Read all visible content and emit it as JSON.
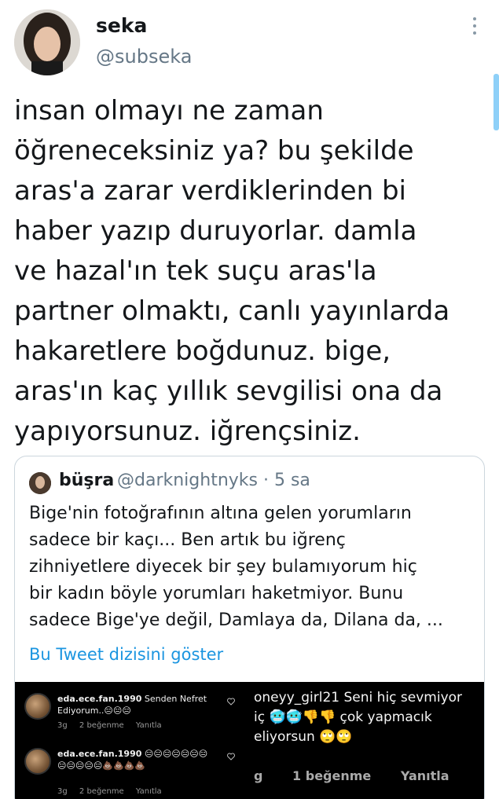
{
  "user": {
    "name": "seka",
    "handle": "@subseka"
  },
  "tweet": {
    "lines": [
      "insan olmayı ne zaman",
      "öğreneceksiniz ya? bu şekilde",
      "aras'a zarar verdiklerinden bi",
      "haber yazıp duruyorlar. damla",
      "ve hazal'ın tek suçu aras'la",
      "partner olmaktı, canlı yayınlarda",
      "hakaretlere boğdunuz. bige,",
      "aras'ın kaç yıllık sevgilisi ona da",
      "yapıyorsunuz. iğrençsiniz."
    ]
  },
  "quote": {
    "name": "büşra",
    "handle_time": "@darknightnyks · 5 sa",
    "lines": [
      "Bige'nin fotoğrafının altına gelen yorumların",
      "sadece bir kaçı... Ben artık bu iğrenç",
      "zihniyetlere diyecek bir şey bulamıyorum hiç",
      "bir kadın böyle yorumları haketmiyor. Bunu",
      "sadece Bige'ye değil, Damlaya da, Dilana da, ..."
    ],
    "show_thread": "Bu Tweet dizisini göster"
  },
  "media": {
    "left": {
      "comment1": {
        "user": "eda.ece.fan.1990",
        "text": "Senden Nefret Ediyorum..😑😑😑",
        "time": "3g",
        "likes": "2 beğenme",
        "reply": "Yanıtla"
      },
      "comment2": {
        "user": "eda.ece.fan.1990",
        "text": "😑😑😑😑😑😑😑😑😑😑😑😑💩💩💩💩",
        "time": "3g",
        "likes": "2 beğenme",
        "reply": "Yanıtla"
      }
    },
    "right": {
      "line1": "oneyy_girl21 Seni hiç sevmiyor",
      "line2": "iç 🥶🥶👎👎 çok yapmacık",
      "line3": "eliyorsun 🙄🙄",
      "time": "g",
      "likes": "1 beğenme",
      "reply": "Yanıtla"
    }
  }
}
